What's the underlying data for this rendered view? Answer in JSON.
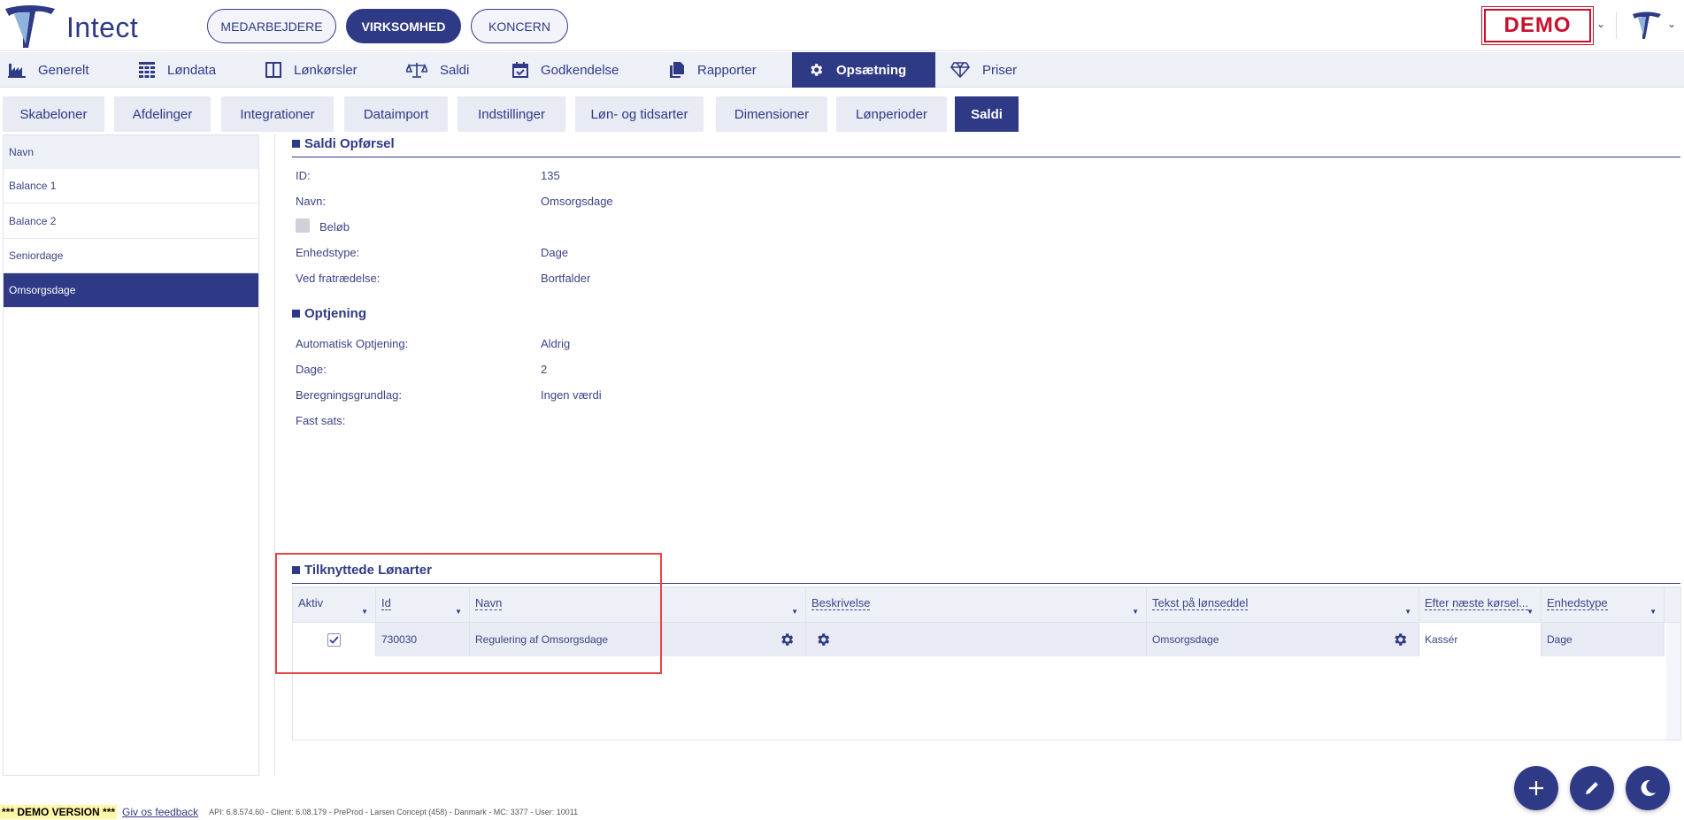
{
  "header": {
    "logo_text": "Intect",
    "segments": [
      "MEDARBEJDERE",
      "VIRKSOMHED",
      "KONCERN"
    ],
    "active_segment": "VIRKSOMHED",
    "demo_label": "DEMO"
  },
  "mainnav": [
    {
      "label": "Generelt",
      "icon": "factory-icon"
    },
    {
      "label": "Løndata",
      "icon": "grid-icon"
    },
    {
      "label": "Lønkørsler",
      "icon": "columns-icon"
    },
    {
      "label": "Saldi",
      "icon": "scale-icon"
    },
    {
      "label": "Godkendelse",
      "icon": "calendar-check-icon"
    },
    {
      "label": "Rapporter",
      "icon": "files-icon"
    },
    {
      "label": "Opsætning",
      "icon": "gear-icon",
      "active": true
    },
    {
      "label": "Priser",
      "icon": "diamond-icon"
    }
  ],
  "subtabs": [
    "Skabeloner",
    "Afdelinger",
    "Integrationer",
    "Dataimport",
    "Indstillinger",
    "Løn- og tidsarter",
    "Dimensioner",
    "Lønperioder",
    "Saldi"
  ],
  "active_subtab": "Saldi",
  "list": {
    "header": "Navn",
    "items": [
      "Balance 1",
      "Balance 2",
      "Seniordage",
      "Omsorgsdage"
    ],
    "selected": "Omsorgsdage"
  },
  "saldi": {
    "title": "Saldi Opførsel",
    "id_label": "ID:",
    "id_value": "135",
    "navn_label": "Navn:",
    "navn_value": "Omsorgsdage",
    "belob_label": "Beløb",
    "enhed_label": "Enhedstype:",
    "enhed_value": "Dage",
    "fratr_label": "Ved fratrædelse:",
    "fratr_value": "Bortfalder"
  },
  "optjening": {
    "title": "Optjening",
    "auto_label": "Automatisk Optjening:",
    "auto_value": "Aldrig",
    "dage_label": "Dage:",
    "dage_value": "2",
    "grund_label": "Beregningsgrundlag:",
    "grund_value": "Ingen værdi",
    "fast_label": "Fast sats:"
  },
  "grid": {
    "title": "Tilknyttede Lønarter",
    "columns": [
      "Aktiv",
      "Id",
      "Navn",
      "Beskrivelse",
      "Tekst på lønseddel",
      "Efter næste kørsel...",
      "Enhedstype"
    ],
    "rows": [
      {
        "aktiv": true,
        "id": "730030",
        "navn": "Regulering af Omsorgsdage",
        "beskrivelse": "",
        "tekst": "Omsorgsdage",
        "efter": "Kassér",
        "enhed": "Dage"
      }
    ]
  },
  "footer": {
    "demo_version": "*** DEMO VERSION ***",
    "feedback": "Giv os feedback",
    "info": "API: 6.8.574.60 - Client: 6.08.179 - PreProd  - Larsen Concept (458) - Danmark - MC: 3377  - User: 10011"
  },
  "colors": {
    "primary": "#2f3a86",
    "demo": "#c8102e",
    "highlight": "#e64545"
  }
}
